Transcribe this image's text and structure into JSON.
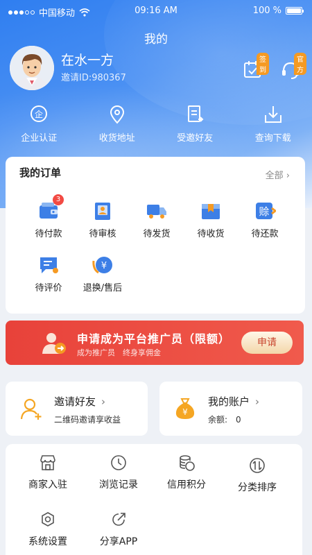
{
  "status_bar": {
    "carrier": "中国移动",
    "time": "09:16 AM",
    "battery": "100 %"
  },
  "page_title": "我的",
  "profile": {
    "name": "在水一方",
    "invite_id": "邀请ID:980367"
  },
  "badges": {
    "checkin": "签到",
    "service": "官方"
  },
  "quick_actions": [
    {
      "label": "企业认证",
      "icon": "company-certify-icon"
    },
    {
      "label": "收货地址",
      "icon": "location-pin-icon"
    },
    {
      "label": "受邀好友",
      "icon": "invited-friends-icon"
    },
    {
      "label": "查询下载",
      "icon": "download-icon"
    }
  ],
  "orders": {
    "title": "我的订单",
    "all_label": "全部",
    "items": [
      {
        "label": "待付款",
        "icon": "wallet-icon",
        "badge": "3"
      },
      {
        "label": "待审核",
        "icon": "review-icon"
      },
      {
        "label": "待发货",
        "icon": "truck-icon"
      },
      {
        "label": "待收货",
        "icon": "package-icon"
      },
      {
        "label": "待还款",
        "icon": "repay-icon",
        "icon_text": "赊"
      },
      {
        "label": "待评价",
        "icon": "comment-icon"
      },
      {
        "label": "退换/售后",
        "icon": "refund-icon",
        "icon_text": "¥"
      }
    ]
  },
  "promo": {
    "title": "申请成为平台推广员（限额）",
    "subtitle": "成为推广员　终身享佣金",
    "button": "申请"
  },
  "invite": {
    "title": "邀请好友",
    "subtitle": "二维码邀请享收益"
  },
  "account": {
    "title": "我的账户",
    "subtitle": "余额:　0",
    "icon_text": "¥"
  },
  "tools": [
    {
      "label": "商家入驻",
      "icon": "store-icon"
    },
    {
      "label": "浏览记录",
      "icon": "clock-icon"
    },
    {
      "label": "信用积分",
      "icon": "coins-icon"
    },
    {
      "label": "分类排序",
      "icon": "sort-icon"
    },
    {
      "label": "系统设置",
      "icon": "settings-icon"
    },
    {
      "label": "分享APP",
      "icon": "share-icon"
    }
  ],
  "colors": {
    "primary": "#2f7ef0",
    "accent_orange": "#f59a23",
    "promo_red": "#e8423a",
    "badge_red": "#f24a43"
  }
}
